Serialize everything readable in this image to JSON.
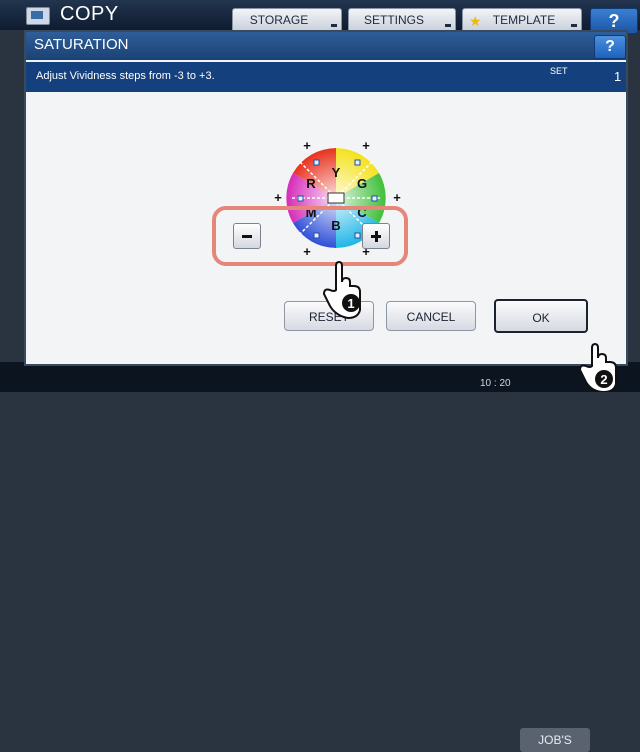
{
  "header": {
    "title": "COPY",
    "tabs": [
      {
        "label": "STORAGE"
      },
      {
        "label": "SETTINGS"
      },
      {
        "label": "TEMPLATE"
      }
    ],
    "help_label": "?"
  },
  "dialog": {
    "title": "SATURATION",
    "help_label": "?",
    "instruction": "Adjust Vividness steps from -3 to +3.",
    "set_label": "SET",
    "set_value": "1",
    "wheel_labels": {
      "y": "Y",
      "g": "G",
      "c": "C",
      "b": "B",
      "m": "M",
      "r": "R"
    },
    "buttons": {
      "reset": "RESET",
      "cancel": "CANCEL",
      "ok": "OK"
    }
  },
  "callouts": {
    "step1": "1",
    "step2": "2"
  },
  "status": {
    "time": "10 : 20",
    "jobs_label": "JOB'S"
  },
  "colors": {
    "title_bar": "#1a4274",
    "info_bar": "#15407e",
    "highlight": "#e5867b"
  }
}
